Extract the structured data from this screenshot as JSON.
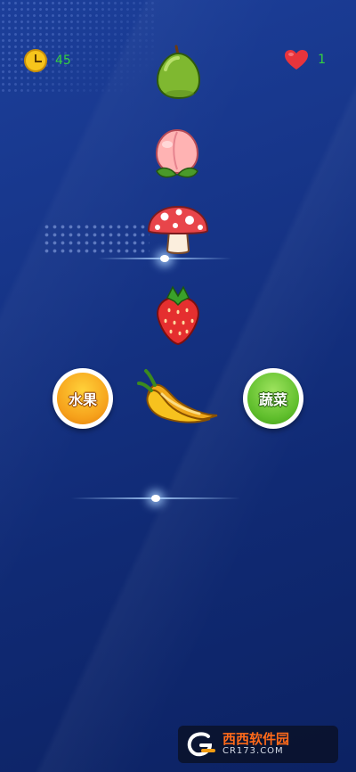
{
  "hud": {
    "timer_icon": "clock-icon",
    "timer_value": "45",
    "lives_icon": "heart-icon",
    "lives_value": "1"
  },
  "items": [
    {
      "name": "guava",
      "icon": "guava-icon"
    },
    {
      "name": "peach",
      "icon": "peach-icon"
    },
    {
      "name": "mushroom",
      "icon": "mushroom-icon"
    },
    {
      "name": "strawberry",
      "icon": "strawberry-icon"
    },
    {
      "name": "chili-pepper",
      "icon": "chili-pepper-icon"
    }
  ],
  "buttons": {
    "fruit_label": "水果",
    "vegetable_label": "蔬菜"
  },
  "watermark": {
    "brand_text": "西西软件园",
    "domain_text": "CR173.COM"
  },
  "colors": {
    "background": "#163487",
    "hud_text": "#35d23f",
    "fruit_button": "#f6a11b",
    "vegetable_button": "#5fbe2c"
  }
}
